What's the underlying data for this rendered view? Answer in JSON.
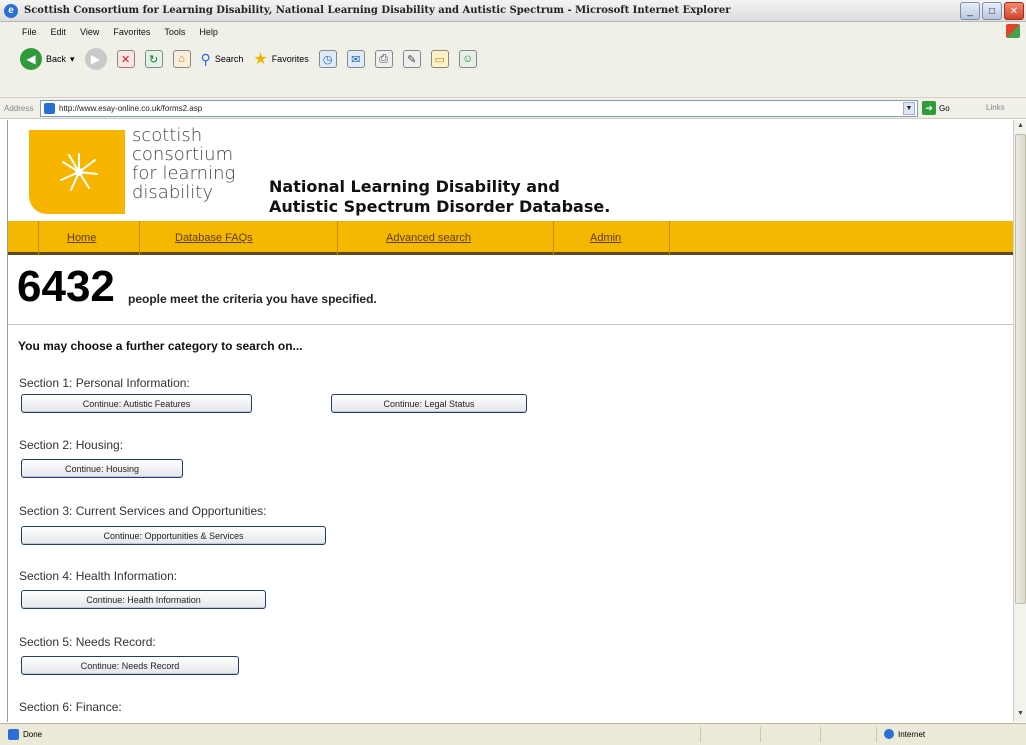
{
  "window": {
    "title": "Scottish Consortium for Learning Disability, National Learning Disability and Autistic Spectrum - Microsoft Internet Explorer"
  },
  "menu": [
    "File",
    "Edit",
    "View",
    "Favorites",
    "Tools",
    "Help"
  ],
  "toolbar": {
    "back_label": "Back",
    "search_label": "Search",
    "favorites_label": "Favorites"
  },
  "address": {
    "label": "Address",
    "url": "http://www.esay-online.co.uk/forms2.asp",
    "go_label": "Go",
    "links_label": "Links"
  },
  "site": {
    "logo_lines": [
      "scottish",
      "consortium",
      "for learning",
      "disability"
    ],
    "db_title_line1": "National Learning Disability and",
    "db_title_line2": "Autistic Spectrum Disorder Database.",
    "nav": [
      "Home",
      "Database FAQs",
      "Advanced search",
      "Admin"
    ]
  },
  "results": {
    "count": "6432",
    "count_text": "people meet the criteria you have specified.",
    "prompt": "You may choose a further category to search on..."
  },
  "sections": [
    {
      "label": "Section 1: Personal Information:",
      "buttons": [
        "Continue: Autistic Features",
        "Continue: Legal Status"
      ]
    },
    {
      "label": "Section 2: Housing:",
      "buttons": [
        "Continue: Housing"
      ]
    },
    {
      "label": "Section 3: Current Services and Opportunities:",
      "buttons": [
        "Continue: Opportunities & Services"
      ]
    },
    {
      "label": "Section 4: Health Information:",
      "buttons": [
        "Continue: Health Information"
      ]
    },
    {
      "label": "Section 5: Needs Record:",
      "buttons": [
        "Continue: Needs Record"
      ]
    },
    {
      "label": "Section 6: Finance:",
      "buttons": []
    }
  ],
  "status": {
    "left": "Done",
    "zone": "Internet"
  }
}
